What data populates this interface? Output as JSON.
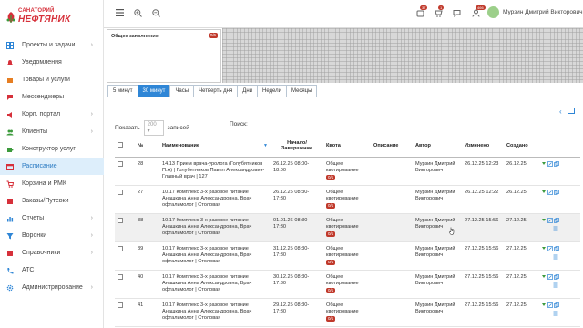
{
  "logo": {
    "top": "САНАТОРИЙ",
    "main": "НЕФТЯНИК"
  },
  "sidebar": {
    "items": [
      {
        "label": "Проекты и задачи",
        "icon": "grid-icon",
        "chevron": true
      },
      {
        "label": "Уведомления",
        "icon": "bell-icon",
        "chevron": false
      },
      {
        "label": "Товары и услуги",
        "icon": "box-icon",
        "chevron": false
      },
      {
        "label": "Мессенджеры",
        "icon": "chat-icon",
        "chevron": false
      },
      {
        "label": "Корп. портал",
        "icon": "megaphone-icon",
        "chevron": true
      },
      {
        "label": "Клиенты",
        "icon": "people-icon",
        "chevron": true
      },
      {
        "label": "Конструктор услуг",
        "icon": "puzzle-icon",
        "chevron": false
      },
      {
        "label": "Расписание",
        "icon": "calendar-icon",
        "chevron": false
      },
      {
        "label": "Корзина и РМК",
        "icon": "cart-icon",
        "chevron": false
      },
      {
        "label": "Заказы/Путевки",
        "icon": "orders-icon",
        "chevron": false
      },
      {
        "label": "Отчеты",
        "icon": "report-icon",
        "chevron": true
      },
      {
        "label": "Воронки",
        "icon": "funnel-icon",
        "chevron": true
      },
      {
        "label": "Справочники",
        "icon": "book-icon",
        "chevron": true
      },
      {
        "label": "АТС",
        "icon": "phone-icon",
        "chevron": false
      },
      {
        "label": "Администрирование",
        "icon": "gear-icon",
        "chevron": true
      }
    ]
  },
  "topbar": {
    "badges": {
      "notifications": "37",
      "cart": "1",
      "messages": "",
      "users": "466"
    },
    "user_name": "Мурзин Дмитрий Викторович"
  },
  "card": {
    "title": "Общее заполнение",
    "count": "0/6"
  },
  "tabs": [
    "5 минут",
    "30 минут",
    "Часы",
    "Четверть дня",
    "Дни",
    "Недели",
    "Месяцы"
  ],
  "active_tab": 1,
  "table_controls": {
    "show_label": "Показать",
    "page_size": "200",
    "records_label": "записей",
    "search_label": "Поиск:"
  },
  "columns": [
    "№",
    "Наименование",
    "Начало/ Завершение",
    "Квота",
    "Описание",
    "Автор",
    "Изменено",
    "Создано"
  ],
  "rows": [
    {
      "num": "28",
      "name": "14.13 Прием врача-уролога (Голубятников П.А) | Голубятников Павел Александрович-Главный врач | 127",
      "time": "26.12.25 08:00-18:00",
      "quota": "Общее квотирование",
      "qbadge": "0/1",
      "author": "Мурзин Дмитрий Викторович",
      "changed": "26.12.25 12:23",
      "created": "26.12.25"
    },
    {
      "num": "27",
      "name": "10.17 Комплекс 3-х разовое питание | Анашкина Анна Александровна, Врач офтальмолог | Столовая",
      "time": "26.12.25 08:30-17:30",
      "quota": "Общее квотирование",
      "qbadge": "0/1",
      "author": "Мурзин Дмитрий Викторович",
      "changed": "26.12.25 12:22",
      "created": "26.12.25"
    },
    {
      "num": "38",
      "name": "10.17 Комплекс 3-х разовое питание | Анашкина Анна Александровна, Врач офтальмолог | Столовая",
      "time": "01.01.26 08:30-17:30",
      "quota": "Общее квотирование",
      "qbadge": "0/1",
      "author": "Мурзин Дмитрий Викторович",
      "changed": "27.12.25 15:56",
      "created": "27.12.25"
    },
    {
      "num": "39",
      "name": "10.17 Комплекс 3-х разовое питание | Анашкина Анна Александровна, Врач офтальмолог | Столовая",
      "time": "31.12.25 08:30-17:30",
      "quota": "Общее квотирование",
      "qbadge": "0/1",
      "author": "Мурзин Дмитрий Викторович",
      "changed": "27.12.25 15:56",
      "created": "27.12.25"
    },
    {
      "num": "40",
      "name": "10.17 Комплекс 3-х разовое питание | Анашкина Анна Александровна, Врач офтальмолог | Столовая",
      "time": "30.12.25 08:30-17:30",
      "quota": "Общее квотирование",
      "qbadge": "0/1",
      "author": "Мурзин Дмитрий Викторович",
      "changed": "27.12.25 15:56",
      "created": "27.12.25"
    },
    {
      "num": "41",
      "name": "10.17 Комплекс 3-х разовое питание | Анашкина Анна Александровна, Врач офтальмолог | Столовая",
      "time": "29.12.25 08:30-17:30",
      "quota": "Общее квотирование",
      "qbadge": "0/1",
      "author": "Мурзин Дмитрий Викторович",
      "changed": "27.12.25 15:56",
      "created": "27.12.25"
    }
  ],
  "colors": {
    "accent": "#2f86d6",
    "brand": "#d6303a",
    "badge": "#c0392b"
  }
}
